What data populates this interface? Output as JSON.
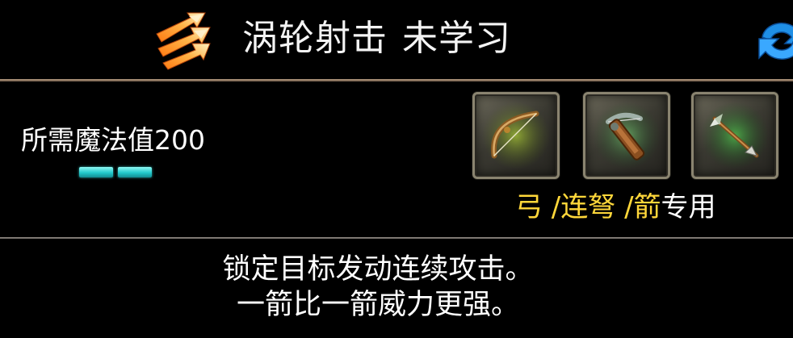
{
  "header": {
    "skill_name": "涡轮射击",
    "learn_status": "未学习",
    "skill_icon": "triple-arrow-icon",
    "refresh_icon": "refresh-icon"
  },
  "requirement": {
    "mana_label": "所需魔法值200",
    "mana_pips_filled": 2,
    "pip_color": "#2fd6d8"
  },
  "weapons": {
    "slots": [
      {
        "icon": "bow-icon"
      },
      {
        "icon": "crossbow-icon"
      },
      {
        "icon": "arrow-icon"
      }
    ],
    "caption": {
      "bow": "弓",
      "sep1": " /",
      "crossbow": "连弩",
      "sep2": " /",
      "arrow": "箭",
      "suffix": "专用"
    },
    "highlight_color": "#ffd73a"
  },
  "description": {
    "line1": "锁定目标发动连续攻击。",
    "line2": "一箭比一箭威力更强。"
  }
}
